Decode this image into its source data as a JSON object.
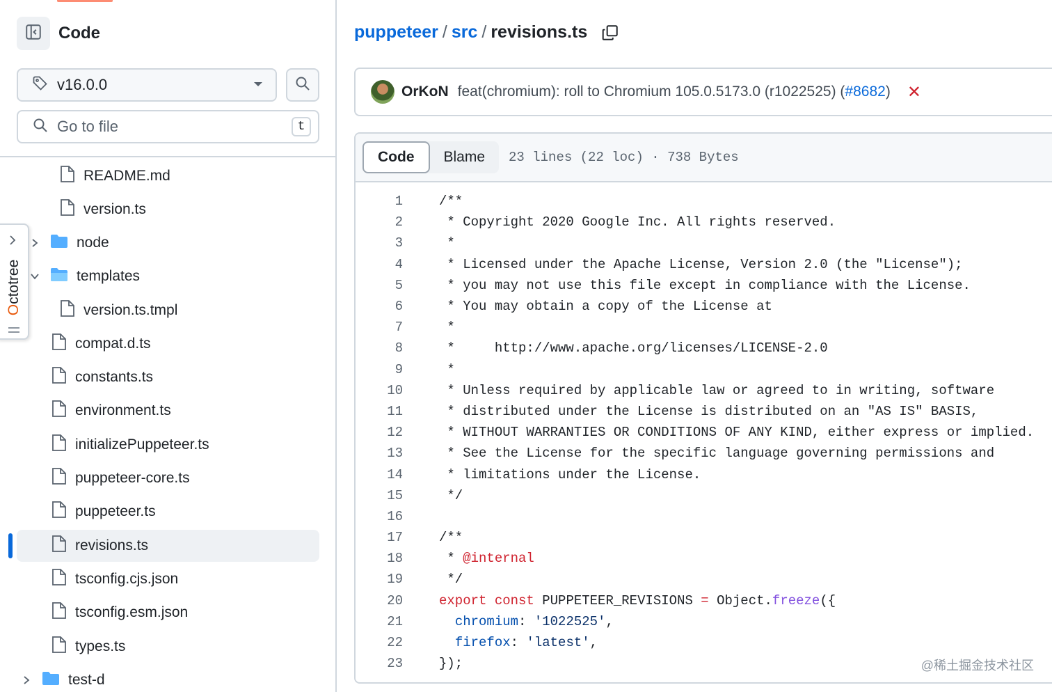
{
  "sidebar": {
    "title": "Code",
    "branch": "v16.0.0",
    "goto_placeholder": "Go to file",
    "goto_shortcut": "t",
    "tree": [
      {
        "name": "README.md",
        "type": "file"
      },
      {
        "name": "version.ts",
        "type": "file"
      },
      {
        "name": "node",
        "type": "folder",
        "expanded": false
      },
      {
        "name": "templates",
        "type": "folder",
        "expanded": true
      },
      {
        "name": "version.ts.tmpl",
        "type": "file"
      },
      {
        "name": "compat.d.ts",
        "type": "file"
      },
      {
        "name": "constants.ts",
        "type": "file"
      },
      {
        "name": "environment.ts",
        "type": "file"
      },
      {
        "name": "initializePuppeteer.ts",
        "type": "file"
      },
      {
        "name": "puppeteer-core.ts",
        "type": "file"
      },
      {
        "name": "puppeteer.ts",
        "type": "file"
      },
      {
        "name": "revisions.ts",
        "type": "file",
        "active": true
      },
      {
        "name": "tsconfig.cjs.json",
        "type": "file"
      },
      {
        "name": "tsconfig.esm.json",
        "type": "file"
      },
      {
        "name": "types.ts",
        "type": "file"
      },
      {
        "name": "test-d",
        "type": "folder",
        "expanded": false
      }
    ]
  },
  "octotree": {
    "first": "O",
    "rest": "ctotree"
  },
  "breadcrumb": {
    "repo": "puppeteer",
    "dir": "src",
    "file": "revisions.ts",
    "sep": "/"
  },
  "commit": {
    "author": "OrKoN",
    "message": "feat(chromium): roll to Chromium 105.0.5173.0 (r1022525) (",
    "pr": "#8682",
    "message_end": ")",
    "status_icon": "x-icon"
  },
  "code_view": {
    "tabs": [
      "Code",
      "Blame"
    ],
    "stats": "23 lines (22 loc) · 738 Bytes",
    "lines": [
      "/**",
      " * Copyright 2020 Google Inc. All rights reserved.",
      " *",
      " * Licensed under the Apache License, Version 2.0 (the \"License\");",
      " * you may not use this file except in compliance with the License.",
      " * You may obtain a copy of the License at",
      " *",
      " *     http://www.apache.org/licenses/LICENSE-2.0",
      " *",
      " * Unless required by applicable law or agreed to in writing, software",
      " * distributed under the License is distributed on an \"AS IS\" BASIS,",
      " * WITHOUT WARRANTIES OR CONDITIONS OF ANY KIND, either express or implied.",
      " * See the License for the specific language governing permissions and",
      " * limitations under the License.",
      " */",
      "",
      "/**",
      " * @internal",
      " */",
      "export const PUPPETEER_REVISIONS = Object.freeze({",
      "  chromium: '1022525',",
      "  firefox: 'latest',",
      "});"
    ]
  },
  "watermark": "@稀土掘金技术社区",
  "colors": {
    "link": "#0969da",
    "accent": "#fd8c73",
    "keyword": "#cf222e",
    "function": "#8250df"
  }
}
